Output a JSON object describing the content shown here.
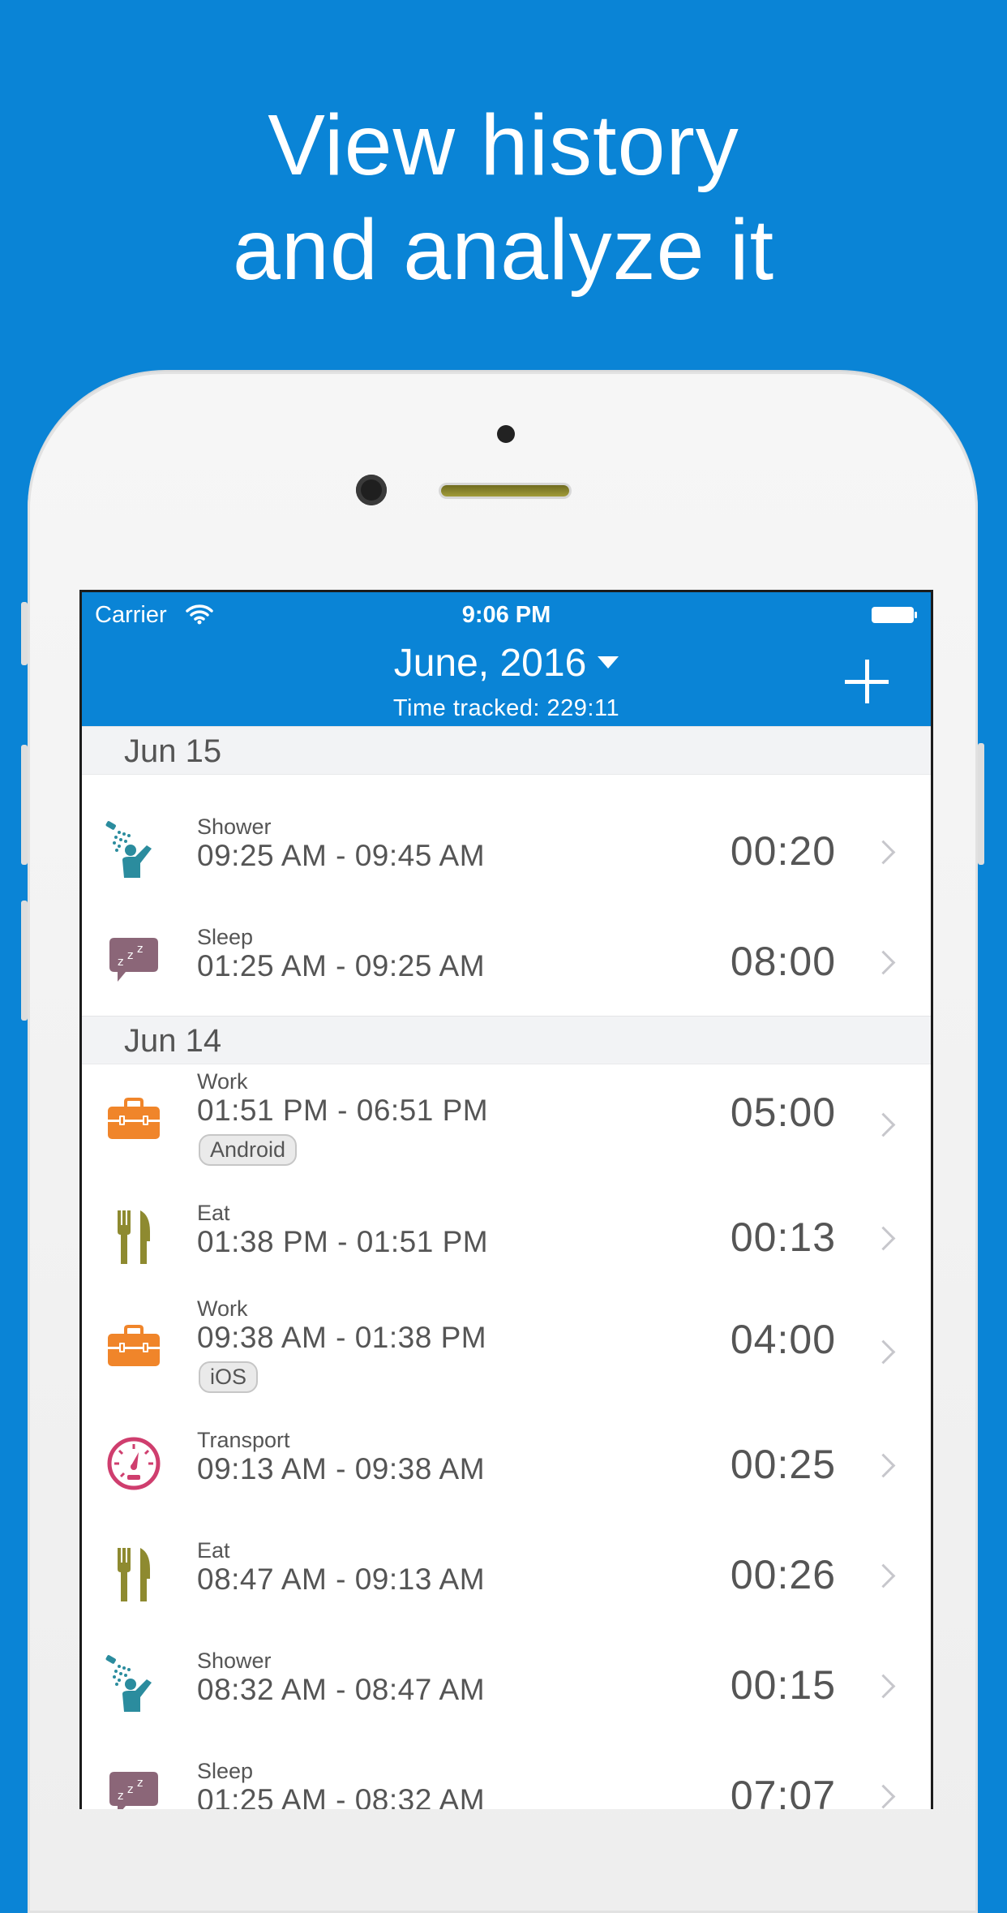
{
  "headline": {
    "line1": "View history",
    "line2": "and analyze it"
  },
  "status_bar": {
    "carrier": "Carrier",
    "time": "9:06 PM"
  },
  "nav": {
    "month": "June, 2016",
    "time_tracked": "Time tracked: 229:11"
  },
  "colors": {
    "accent": "#0A84D6",
    "shower": "#2B8C9E",
    "sleep": "#8B6678",
    "work": "#F0852A",
    "eat": "#8E8A30",
    "transport": "#CF3E6E"
  },
  "sections": [
    {
      "date": "Jun 15",
      "entries": [
        {
          "category": "Shower",
          "range": "09:25 AM - 09:45 AM",
          "duration": "00:20",
          "icon": "shower-icon"
        },
        {
          "category": "Sleep",
          "range": "01:25 AM - 09:25 AM",
          "duration": "08:00",
          "icon": "sleep-icon"
        }
      ]
    },
    {
      "date": "Jun 14",
      "entries": [
        {
          "category": "Work",
          "range": "01:51 PM - 06:51 PM",
          "duration": "05:00",
          "tag": "Android",
          "icon": "toolbox-icon"
        },
        {
          "category": "Eat",
          "range": "01:38 PM - 01:51 PM",
          "duration": "00:13",
          "icon": "fork-knife-icon"
        },
        {
          "category": "Work",
          "range": "09:38 AM - 01:38 PM",
          "duration": "04:00",
          "tag": "iOS",
          "icon": "toolbox-icon"
        },
        {
          "category": "Transport",
          "range": "09:13 AM - 09:38 AM",
          "duration": "00:25",
          "icon": "speedometer-icon"
        },
        {
          "category": "Eat",
          "range": "08:47 AM - 09:13 AM",
          "duration": "00:26",
          "icon": "fork-knife-icon"
        },
        {
          "category": "Shower",
          "range": "08:32 AM - 08:47 AM",
          "duration": "00:15",
          "icon": "shower-icon"
        },
        {
          "category": "Sleep",
          "range": "01:25 AM - 08:32 AM",
          "duration": "07:07",
          "icon": "sleep-icon"
        }
      ]
    }
  ]
}
